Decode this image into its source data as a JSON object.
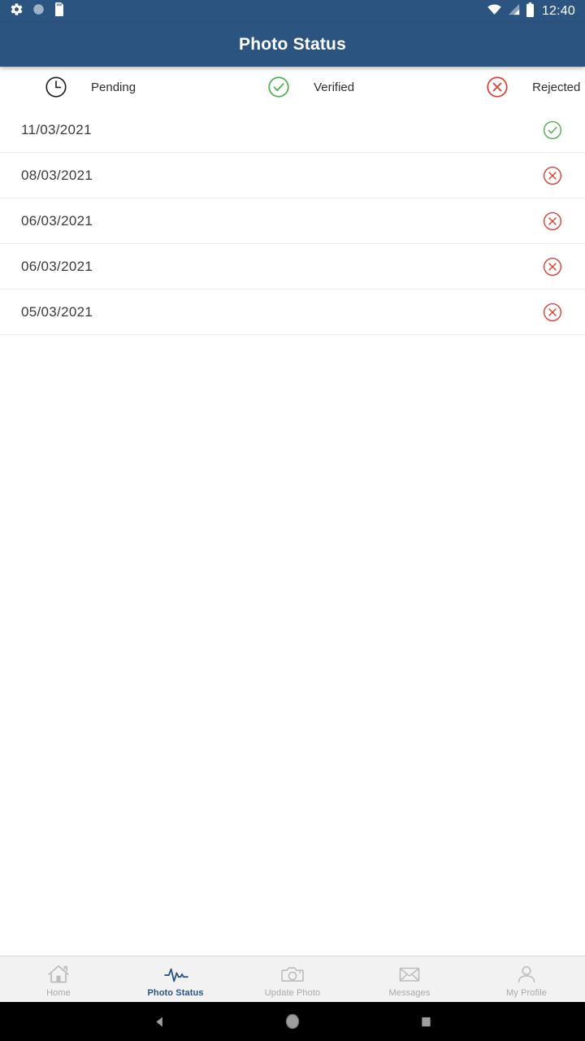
{
  "status_bar": {
    "time": "12:40",
    "left_icons": [
      {
        "name": "settings-gear-icon"
      },
      {
        "name": "circle-indicator-icon"
      },
      {
        "name": "sd-card-icon"
      }
    ],
    "right_icons": [
      {
        "name": "wifi-icon"
      },
      {
        "name": "cellular-signal-icon"
      },
      {
        "name": "battery-full-icon"
      }
    ]
  },
  "app_bar": {
    "title": "Photo Status"
  },
  "legend": {
    "items": [
      {
        "label": "Pending",
        "icon": "clock-icon",
        "color": "#1d1d1d"
      },
      {
        "label": "Verified",
        "icon": "check-circle-icon",
        "color": "#4caf50"
      },
      {
        "label": "Rejected",
        "icon": "x-circle-icon",
        "color": "#e03c31"
      }
    ]
  },
  "list": {
    "rows": [
      {
        "date": "11/03/2021",
        "status": "verified",
        "status_icon": "check-circle-icon",
        "color": "#4caf50"
      },
      {
        "date": "08/03/2021",
        "status": "rejected",
        "status_icon": "x-circle-icon",
        "color": "#e03c31"
      },
      {
        "date": "06/03/2021",
        "status": "rejected",
        "status_icon": "x-circle-icon",
        "color": "#e03c31"
      },
      {
        "date": "06/03/2021",
        "status": "rejected",
        "status_icon": "x-circle-icon",
        "color": "#e03c31"
      },
      {
        "date": "05/03/2021",
        "status": "rejected",
        "status_icon": "x-circle-icon",
        "color": "#e03c31"
      }
    ]
  },
  "bottom_nav": {
    "items": [
      {
        "label": "Home",
        "icon": "home-icon",
        "active": false
      },
      {
        "label": "Photo Status",
        "icon": "pulse-icon",
        "active": true
      },
      {
        "label": "Update Photo",
        "icon": "camera-icon",
        "active": false
      },
      {
        "label": "Messages",
        "icon": "envelope-icon",
        "active": false
      },
      {
        "label": "My Profile",
        "icon": "person-icon",
        "active": false
      }
    ]
  },
  "system_nav": {
    "buttons": [
      {
        "name": "back-button"
      },
      {
        "name": "home-button"
      },
      {
        "name": "recents-button"
      }
    ]
  },
  "colors": {
    "primary": "#2b5580",
    "verified": "#4caf50",
    "rejected": "#e03c31",
    "nav_inactive": "#a9a9a9",
    "divider": "#f0f0f0"
  }
}
